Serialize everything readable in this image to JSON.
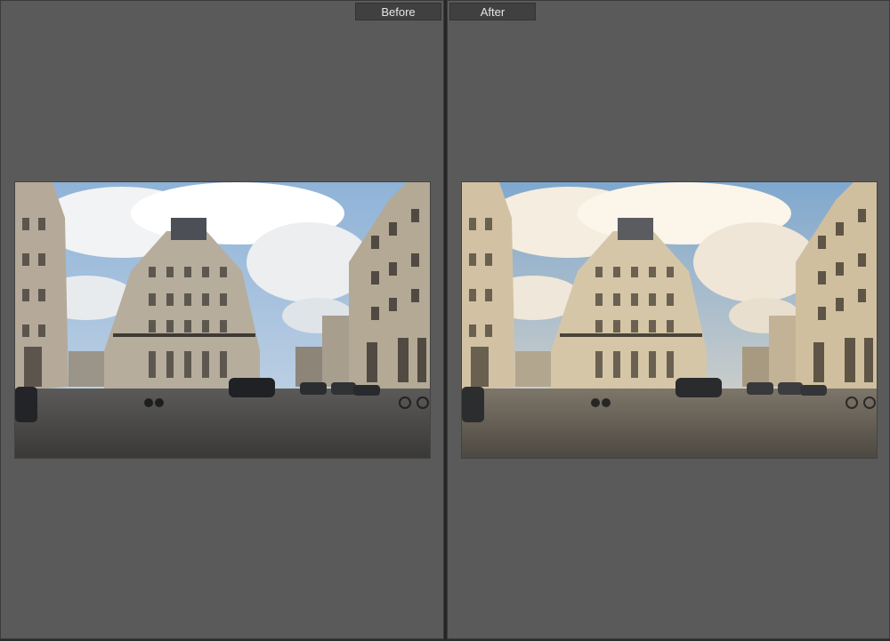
{
  "compare_view": {
    "before_label": "Before",
    "after_label": "After"
  },
  "colors": {
    "panel_bg": "#5a5a5a",
    "tab_bg": "#404040",
    "tab_text": "#e6e6e6"
  }
}
